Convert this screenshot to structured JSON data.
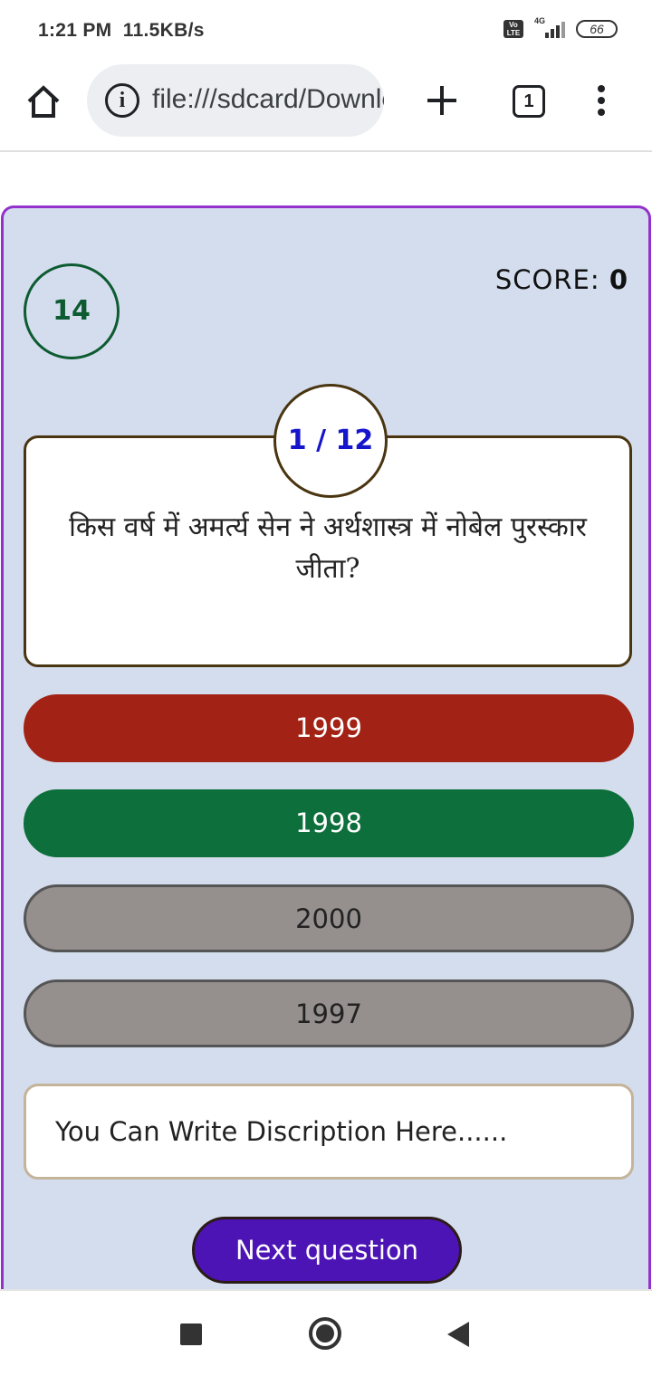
{
  "status_bar": {
    "time": "1:21 PM",
    "speed": "11.5KB/s",
    "volte": "Vo LTE",
    "network": "4G",
    "battery": "66"
  },
  "browser": {
    "url": "file:///sdcard/Download/",
    "tab_count": "1",
    "icons": [
      "home-icon",
      "info-icon",
      "plus-icon",
      "tabs-icon",
      "more-vert-icon"
    ]
  },
  "quiz": {
    "timer": "14",
    "score_label": "SCORE:",
    "score_value": "0",
    "counter": "1 / 12",
    "question": "किस वर्ष में अमर्त्य सेन ने अर्थशास्त्र में नोबेल पुरस्कार जीता?",
    "options": [
      {
        "label": "1999",
        "state": "wrong",
        "color": "#a22315"
      },
      {
        "label": "1998",
        "state": "correct",
        "color": "#0d6f3b"
      },
      {
        "label": "2000",
        "state": "neutral",
        "color": "#958f8e"
      },
      {
        "label": "1997",
        "state": "neutral",
        "color": "#958f8e"
      }
    ],
    "description": "You Can Write Discription Here......",
    "next_label": "Next question",
    "colors": {
      "card_bg": "#d4dded",
      "card_border": "#9231cc",
      "timer": "#0d5b31",
      "counter_text": "#1515cc",
      "next_button": "#4c14b5"
    }
  },
  "nav_bar": {
    "icons": [
      "recents-square-icon",
      "home-circle-icon",
      "back-triangle-icon"
    ]
  }
}
